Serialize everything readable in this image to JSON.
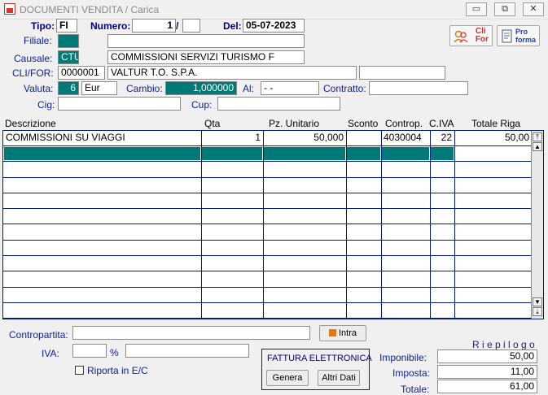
{
  "window": {
    "title": "DOCUMENTI VENDITA / Carica",
    "controls": {
      "minimize": "▭",
      "restore": "⧉",
      "close": "✕"
    }
  },
  "header": {
    "tipo_label": "Tipo:",
    "tipo_value": "FI",
    "numero_label": "Numero:",
    "numero_value": "1",
    "numero_sep": "/",
    "numero_suffix": "",
    "del_label": "Del:",
    "del_value": "05-07-2023",
    "filiale_label": "Filiale:",
    "filiale_code": "",
    "filiale_desc": "",
    "causale_label": "Causale:",
    "causale_code": "CTU",
    "causale_desc": "COMMISSIONI SERVIZI TURISMO  F",
    "clifor_label": "CLI/FOR:",
    "clifor_code": "0000001",
    "clifor_name": "VALTUR T.O. S.P.A.",
    "clifor_extra": "",
    "valuta_label": "Valuta:",
    "valuta_code": "6",
    "valuta_name": "Eur",
    "cambio_label": "Cambio:",
    "cambio_value": "1,000000",
    "al_label": "Al:",
    "al_value": "- -",
    "contratto_label": "Contratto:",
    "contratto_value": "",
    "cig_label": "Cig:",
    "cig_value": "",
    "cup_label": "Cup:",
    "cup_value": ""
  },
  "side_buttons": {
    "clifor": {
      "line1": "Cli",
      "line2": "For"
    },
    "proforma": {
      "line1": "Pro",
      "line2": "forma"
    }
  },
  "grid": {
    "columns": [
      "Descrizione",
      "Qta",
      "Pz. Unitario",
      "Sconto",
      "Controp.",
      "C.IVA",
      "Totale Riga"
    ],
    "rows": [
      {
        "descrizione": "COMMISSIONI SU VIAGGI",
        "qta": "1",
        "pz_unitario": "50,000",
        "sconto": "",
        "controp": "4030004",
        "civa": "22",
        "totale": "50,00"
      }
    ],
    "scroll": {
      "up": "▲",
      "down": "▼",
      "top": "⤒",
      "bottom": "⤓"
    }
  },
  "footer": {
    "contropartita_label": "Contropartita:",
    "contropartita_value": "",
    "intra_label": "Intra",
    "iva_label": "IVA:",
    "iva_value": "",
    "iva_percent": "%",
    "iva_desc": "",
    "riporta_label": "Riporta in E/C",
    "fattura_title": "FATTURA ELETTRONICA",
    "genera_label": "Genera",
    "altri_dati_label": "Altri Dati",
    "riepilogo_label": "R i e p i l o g o",
    "imponibile_label": "Imponibile:",
    "imponibile_value": "50,00",
    "imposta_label": "Imposta:",
    "imposta_value": "11,00",
    "totale_label": "Totale:",
    "totale_value": "61,00"
  },
  "colors": {
    "accent_teal": "#007a78",
    "label_blue": "#0f1e96",
    "grid_line": "#001a7a"
  }
}
